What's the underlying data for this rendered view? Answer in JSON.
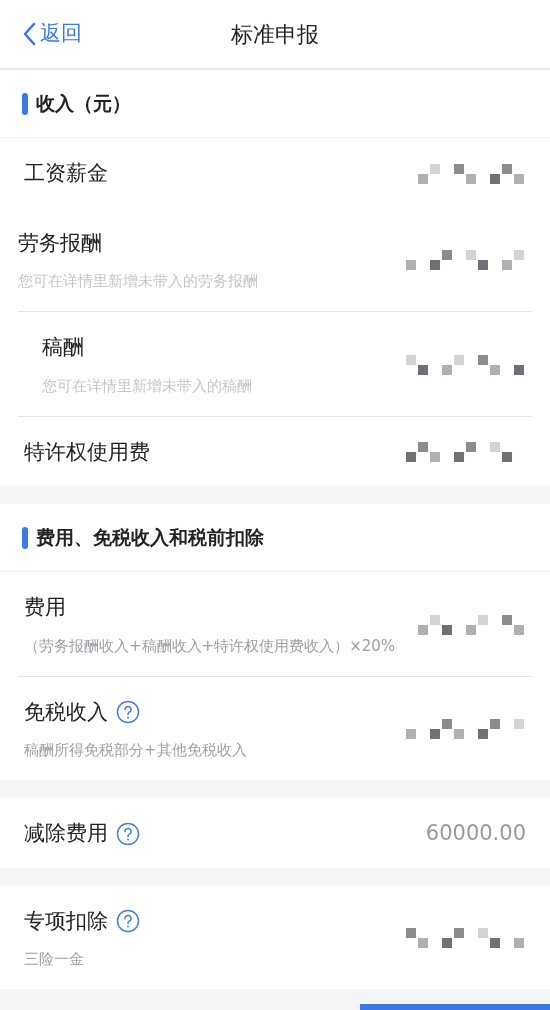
{
  "nav": {
    "back": "返回",
    "title": "标准申报"
  },
  "sections": [
    {
      "header": "收入（元）",
      "rows": [
        {
          "label": "工资薪金",
          "help": false,
          "masked": true
        },
        {
          "label": "劳务报酬",
          "note": "您可在详情里新增未带入的劳务报酬",
          "help": false,
          "masked": true
        },
        {
          "label": "稿酬",
          "note": "您可在详情里新增未带入的稿酬",
          "help": false,
          "masked": true
        },
        {
          "label": "特许权使用费",
          "help": false,
          "masked": true
        }
      ]
    },
    {
      "header": "费用、免税收入和税前扣除",
      "rows": [
        {
          "label": "费用",
          "note": "（劳务报酬收入+稿酬收入+特许权使用费收入）×20%",
          "help": false,
          "masked": true
        },
        {
          "label": "免税收入",
          "note": "稿酬所得免税部分+其他免税收入",
          "help": true,
          "masked": true
        }
      ]
    },
    {
      "rows": [
        {
          "label": "减除费用",
          "help": true,
          "masked": false,
          "value": "60000.00"
        }
      ]
    },
    {
      "rows": [
        {
          "label": "专项扣除",
          "note": "三险一金",
          "help": true,
          "masked": true
        }
      ]
    }
  ]
}
